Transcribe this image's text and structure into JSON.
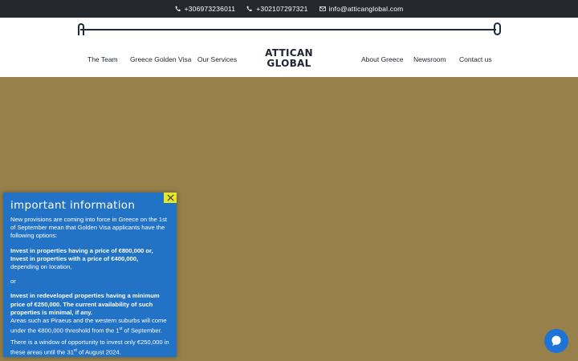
{
  "topbar": {
    "phone1": "+306973236011",
    "phone2": "+302107297321",
    "email": "info@atticanglobal.com"
  },
  "nav": {
    "team": "The Team",
    "golden_visa": "Greece Golden Visa",
    "services": "Our Services",
    "about": "About Greece",
    "newsroom": "Newsroom",
    "contact": "Contact us"
  },
  "logo": {
    "line1": "ATTICAN",
    "line2": "GLOBAL"
  },
  "popup": {
    "title": "important information",
    "intro": "New provisions are coming into force in Greece on the 1st of September mean that Golden Visa applicants have the following options:",
    "option1_a": "Invest in properties having a price of €800,000 or,",
    "option1_b": "Invest in properties with a price of €400,000,",
    "option1_c": "depending on location,",
    "or": "or",
    "option2": "Invest in redeveloped properties having a minimum price of €250,000. The current availability of such properties is minimal, if any.",
    "areas_a": "Areas such as Piraeus and the western suburbs will come under the €800,000 threshold from the 1",
    "areas_sup": "st",
    "areas_b": " of September.",
    "window_a": "There is a window of opportunity to invest only €250,000 in these areas until the 31",
    "window_sup": "st",
    "window_b": " of August 2024."
  },
  "colors": {
    "topbar": "#25282d",
    "background": "#97804a",
    "popup": "#2272c5",
    "close": "#e3e92a",
    "chat": "#1e73d6"
  },
  "icons": [
    "phone-icon",
    "email-icon",
    "close-icon",
    "chat-icon"
  ]
}
